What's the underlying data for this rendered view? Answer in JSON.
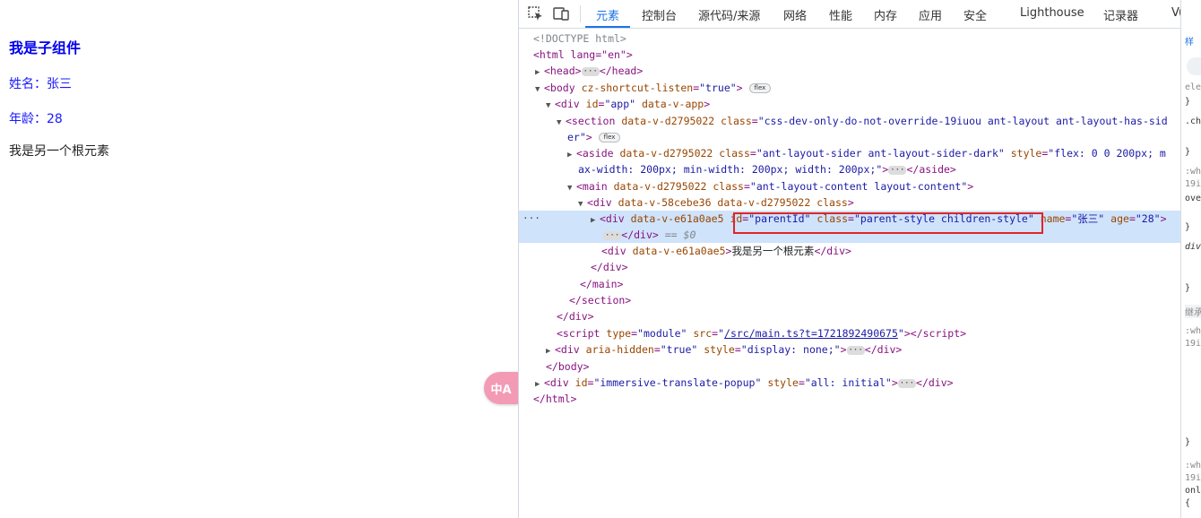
{
  "page": {
    "heading": "我是子组件",
    "name_line": "姓名：张三",
    "age_line": "年龄：28",
    "root_text": "我是另一个根元素"
  },
  "translate_button": {
    "label": "中A"
  },
  "devtools": {
    "tabs": [
      "元素",
      "控制台",
      "源代码/来源",
      "网络",
      "性能",
      "内存",
      "应用",
      "安全",
      "Lighthouse",
      "记录器",
      "Vue"
    ],
    "active_tab": "元素",
    "tree": {
      "doctype": "<!DOCTYPE html>",
      "html_open": "<html lang=\"en\">",
      "head": "<head>",
      "head_close": "</head>",
      "body_tag": "<body",
      "body_attr_name": "cz-shortcut-listen",
      "body_attr_value": "\"true\"",
      "flex_badge": "flex",
      "app_tag": "<div",
      "app_id": "\"app\"",
      "app_attr": "data-v-app",
      "section_tag": "<section",
      "section_attr1": "data-v-d2795022",
      "section_class_l1": "\"css-dev-only-do-not-override-19iuou ant-layout ant-layout-has-sid",
      "section_class_l2": "er\"",
      "aside_attr1": "data-v-d2795022",
      "aside_class": "\"ant-layout-sider ant-layout-sider-dark\"",
      "aside_style_l1": "\"flex: 0 0 200px; m",
      "aside_style_l2": "ax-width: 200px; min-width: 200px; width: 200px;\"",
      "main_attr": "data-v-d2795022",
      "main_class": "\"ant-layout-content layout-content\"",
      "div1_attrs": "data-v-58cebe36 data-v-d2795022 class",
      "sel_attr": "data-v-e61a0ae5",
      "sel_id": "\"parentId\"",
      "sel_class": "\"parent-style children-style\"",
      "sel_name": "\"张三\"",
      "sel_age": "\"28\"",
      "sel_suffix": "== $0",
      "root_div_attr": "data-v-e61a0ae5",
      "root_div_text": "我是另一个根元素",
      "script_src": "/src/main.ts?t=1721892490675",
      "hidden_style": "\"display: none;\"",
      "popup_id": "\"immersive-translate-popup\"",
      "popup_style": "\"all: initial\""
    },
    "side_panel": [
      "样",
      "ele",
      "}",
      ".ch",
      "}",
      ":wh",
      "19i",
      "ove",
      "}",
      "div",
      "}",
      "继承",
      ":wh",
      "19i",
      "}",
      ":wh",
      "19i",
      "onl",
      "{"
    ]
  }
}
